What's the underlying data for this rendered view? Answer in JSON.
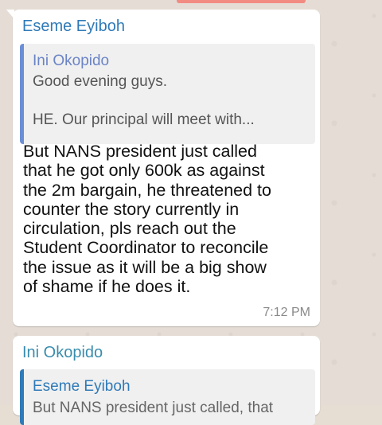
{
  "messages": [
    {
      "sender": "Eseme Eyiboh",
      "sender_color": "#2f7ab8",
      "quoted": {
        "author": "Ini Okopido",
        "lines": [
          "Good evening guys.",
          "HE. Our principal will meet with..."
        ]
      },
      "body_lines": [
        "But NANS president just called",
        "that he got only 600k as against",
        "the 2m bargain, he threatened to",
        "counter the story currently in",
        "circulation, pls reach out the",
        "Student Coordinator to reconcile",
        "the issue as it will be a big show",
        "of shame if he does it."
      ],
      "time": "7:12 PM"
    },
    {
      "sender": "Ini Okopido",
      "sender_color": "#3a8dad",
      "quoted": {
        "author": "Eseme Eyiboh",
        "partial_line": "But NANS president just called, that"
      }
    }
  ]
}
